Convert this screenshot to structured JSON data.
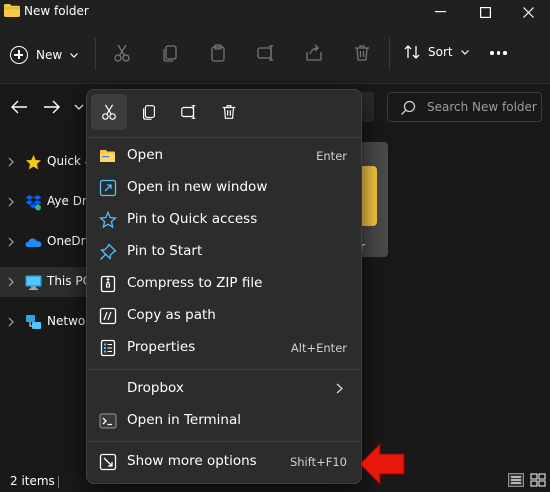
{
  "window": {
    "title": "New folder"
  },
  "toolbar": {
    "new_label": "New",
    "sort_label": "Sort"
  },
  "search": {
    "placeholder": "Search New folder"
  },
  "sidebar": {
    "items": [
      {
        "label": "Quick a",
        "icon": "star-icon"
      },
      {
        "label": "Aye Dro",
        "icon": "dropbox-icon"
      },
      {
        "label": "OneDri",
        "icon": "onedrive-cloud-icon"
      },
      {
        "label": "This PC",
        "icon": "monitor-icon"
      },
      {
        "label": "Networ",
        "icon": "network-icon"
      }
    ]
  },
  "content": {
    "tile_label": "r"
  },
  "status": {
    "item_count": "2 items"
  },
  "context_menu": {
    "items": [
      {
        "label": "Open",
        "shortcut": "Enter",
        "icon": "folder-open-icon"
      },
      {
        "label": "Open in new window",
        "shortcut": "",
        "icon": "open-new-window-icon"
      },
      {
        "label": "Pin to Quick access",
        "shortcut": "",
        "icon": "pin-star-icon"
      },
      {
        "label": "Pin to Start",
        "shortcut": "",
        "icon": "pin-icon"
      },
      {
        "label": "Compress to ZIP file",
        "shortcut": "",
        "icon": "zip-icon"
      },
      {
        "label": "Copy as path",
        "shortcut": "",
        "icon": "copy-path-icon"
      },
      {
        "label": "Properties",
        "shortcut": "Alt+Enter",
        "icon": "properties-icon"
      },
      {
        "label": "Dropbox",
        "shortcut": "",
        "icon": ""
      },
      {
        "label": "Open in Terminal",
        "shortcut": "",
        "icon": "terminal-icon"
      },
      {
        "label": "Show more options",
        "shortcut": "Shift+F10",
        "icon": "show-more-icon"
      }
    ]
  },
  "colors": {
    "accent": "#4cc2ff",
    "folder": "#f5c846",
    "annotation_arrow": "#e8180c"
  }
}
